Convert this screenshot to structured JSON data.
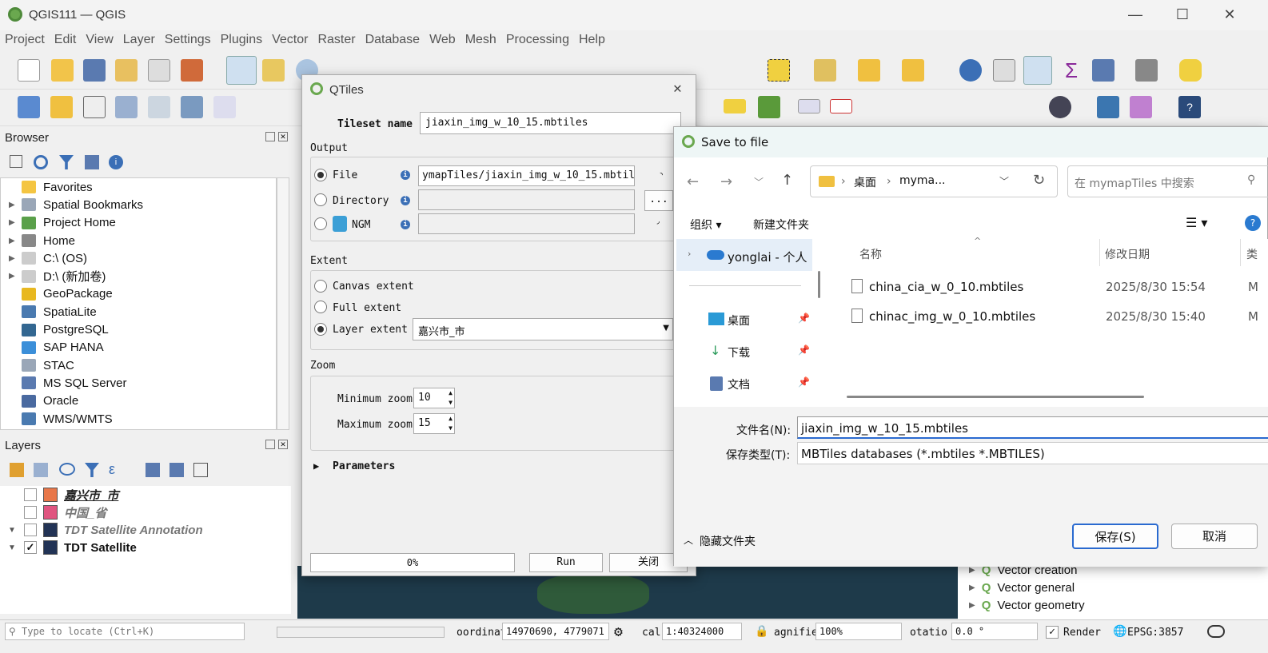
{
  "window": {
    "title": "QGIS111 — QGIS",
    "minimize": "—",
    "maximize": "☐",
    "close": "✕"
  },
  "menu": [
    "Project",
    "Edit",
    "View",
    "Layer",
    "Settings",
    "Plugins",
    "Vector",
    "Raster",
    "Database",
    "Web",
    "Mesh",
    "Processing",
    "Help"
  ],
  "browser": {
    "title": "Browser",
    "items": [
      {
        "label": "Favorites",
        "icon": "star-icon",
        "color": "#f4c542",
        "expand": ""
      },
      {
        "label": "Spatial Bookmarks",
        "icon": "bookmark-icon",
        "color": "#9aa7b8",
        "expand": "▶"
      },
      {
        "label": "Project Home",
        "icon": "project-home-icon",
        "color": "#5aa04a",
        "expand": "▶"
      },
      {
        "label": "Home",
        "icon": "home-icon",
        "color": "#888888",
        "expand": "▶"
      },
      {
        "label": "C:\\ (OS)",
        "icon": "drive-icon",
        "color": "#cccccc",
        "expand": "▶"
      },
      {
        "label": "D:\\ (新加卷)",
        "icon": "drive-icon",
        "color": "#cccccc",
        "expand": "▶"
      },
      {
        "label": "GeoPackage",
        "icon": "geopackage-icon",
        "color": "#e8b820",
        "expand": ""
      },
      {
        "label": "SpatiaLite",
        "icon": "spatialite-icon",
        "color": "#4a7ab0",
        "expand": ""
      },
      {
        "label": "PostgreSQL",
        "icon": "postgresql-icon",
        "color": "#336791",
        "expand": ""
      },
      {
        "label": "SAP HANA",
        "icon": "saphana-icon",
        "color": "#3b8fd9",
        "expand": ""
      },
      {
        "label": "STAC",
        "icon": "stac-icon",
        "color": "#9aa7b8",
        "expand": ""
      },
      {
        "label": "MS SQL Server",
        "icon": "mssql-icon",
        "color": "#5a7ab0",
        "expand": ""
      },
      {
        "label": "Oracle",
        "icon": "oracle-icon",
        "color": "#4a6aa0",
        "expand": ""
      },
      {
        "label": "WMS/WMTS",
        "icon": "wms-icon",
        "color": "#4a7ab0",
        "expand": ""
      }
    ]
  },
  "layers": {
    "title": "Layers",
    "items": [
      {
        "name": "嘉兴市_市",
        "checked": false,
        "color": "#e8774a",
        "style": "underline",
        "expand": ""
      },
      {
        "name": "中国_省",
        "checked": false,
        "color": "#e05580",
        "style": "gray",
        "expand": ""
      },
      {
        "name": "TDT Satellite Annotation",
        "checked": false,
        "color": "#223355",
        "style": "gray",
        "expand": "▼"
      },
      {
        "name": "TDT Satellite",
        "checked": true,
        "color": "#223355",
        "style": "normal",
        "expand": "▼"
      }
    ]
  },
  "qtiles": {
    "title": "QTiles",
    "tileset_label": "Tileset name",
    "tileset_value": "jiaxin_img_w_10_15.mbtiles",
    "output_label": "Output",
    "file_label": "File",
    "file_value": "ymapTiles/jiaxin_img_w_10_15.mbtiles",
    "directory_label": "Directory",
    "ngm_label": "NGM",
    "browse_label": "...",
    "extent_label": "Extent",
    "canvas_label": "Canvas extent",
    "full_label": "Full extent",
    "layer_label": "Layer extent",
    "layer_value": "嘉兴市_市",
    "zoom_label": "Zoom",
    "min_label": "Minimum zoom",
    "min_value": "10",
    "max_label": "Maximum zoom",
    "max_value": "15",
    "params_label": "Parameters",
    "progress": "0%",
    "progress_fraction": 0,
    "run": "Run",
    "close": "关闭"
  },
  "save_dialog": {
    "title": "Save to file",
    "path": [
      "桌面",
      "myma..."
    ],
    "search_placeholder": "在 mymapTiles 中搜索",
    "organize": "组织 ▾",
    "new_folder": "新建文件夹",
    "onedrive": "yonglai - 个人",
    "quick": [
      {
        "label": "桌面",
        "icon": "desktop-icon"
      },
      {
        "label": "下载",
        "icon": "download-icon"
      },
      {
        "label": "文档",
        "icon": "documents-icon"
      }
    ],
    "col_name": "名称",
    "col_date": "修改日期",
    "col_type": "类",
    "files": [
      {
        "name": "china_cia_w_0_10.mbtiles",
        "date": "2025/8/30 15:54",
        "type": "M"
      },
      {
        "name": "chinac_img_w_0_10.mbtiles",
        "date": "2025/8/30 15:40",
        "type": "M"
      }
    ],
    "filename_label": "文件名(N):",
    "filename_value": "jiaxin_img_w_10_15.mbtiles",
    "type_label": "保存类型(T):",
    "type_value": "MBTiles databases (*.mbtiles *.MBTILES)",
    "hide_folders": "隐藏文件夹",
    "save": "保存(S)",
    "cancel": "取消"
  },
  "processing": [
    "Vector creation",
    "Vector general",
    "Vector geometry"
  ],
  "status": {
    "locate_placeholder": "Type to locate (Ctrl+K)",
    "coord_label": "oordinat",
    "coord_value": "14970690, 4779071",
    "scale_label": "cal",
    "scale_value": "1:40324000",
    "mag_label": "agnifie",
    "mag_value": "100%",
    "rot_label": "otatio",
    "rot_value": "0.0 °",
    "render_label": "Render",
    "crs": "EPSG:3857"
  }
}
